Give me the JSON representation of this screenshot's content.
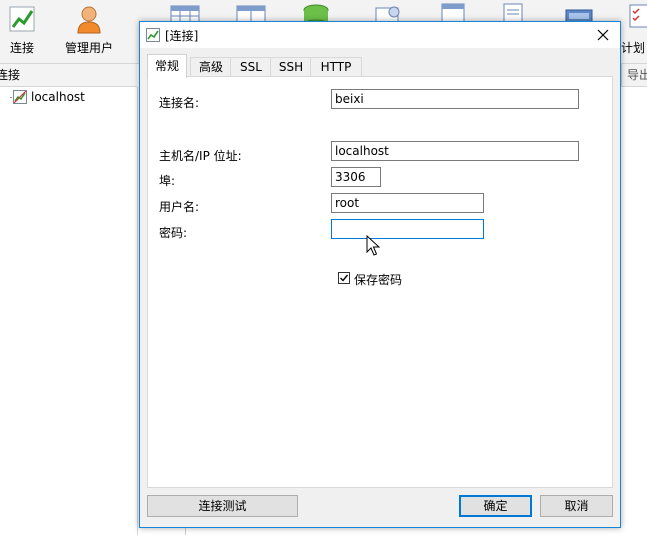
{
  "toolbar": {
    "connect_label": "连接",
    "manage_users_label": "管理用户",
    "schedule_label": "计划"
  },
  "left_panel": {
    "header": "连接",
    "tree_items": [
      {
        "label": "localhost"
      }
    ]
  },
  "right_strip": {
    "header": "导出"
  },
  "dialog": {
    "title": "[连接]",
    "tabs": [
      "常规",
      "高级",
      "SSL",
      "SSH",
      "HTTP"
    ],
    "active_tab": "常规",
    "fields": {
      "connection_name": {
        "label": "连接名:",
        "value": "beixi"
      },
      "host": {
        "label": "主机名/IP 位址:",
        "value": "localhost"
      },
      "port": {
        "label": "埠:",
        "value": "3306"
      },
      "username": {
        "label": "用户名:",
        "value": "root"
      },
      "password": {
        "label": "密码:",
        "value": ""
      }
    },
    "save_password": {
      "label": "保存密码",
      "checked": true
    },
    "buttons": {
      "test": "连接测试",
      "ok": "确定",
      "cancel": "取消"
    }
  },
  "colors": {
    "accent": "#0078d7",
    "dialog_border": "#1883d7",
    "panel_bg": "#f0f0f0"
  }
}
